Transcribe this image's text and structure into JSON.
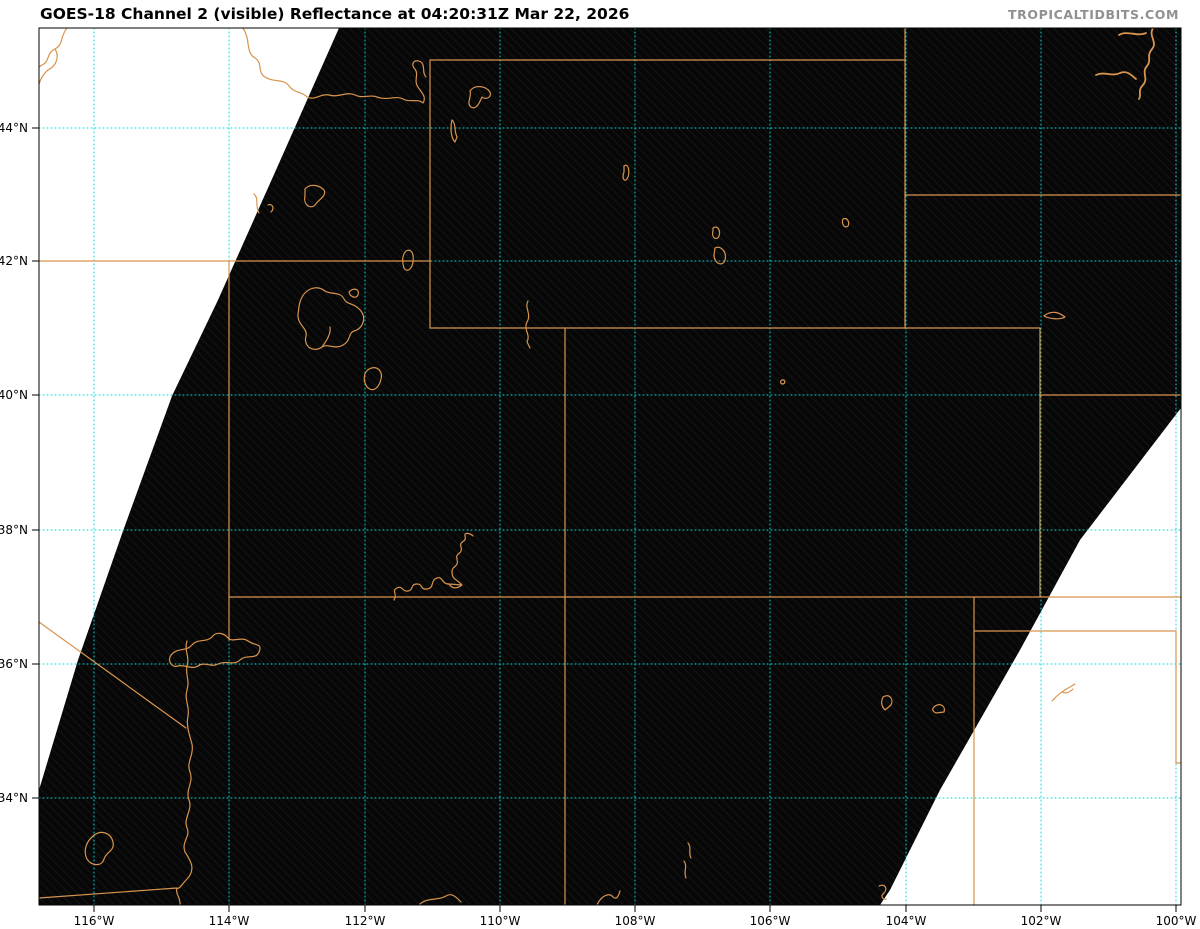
{
  "header": {
    "title": "GOES-18 Channel 2 (visible) Reflectance at 04:20:31Z Mar 22, 2026",
    "watermark": "TROPICALTIDBITS.COM"
  },
  "map": {
    "lat_labels": [
      "44°N",
      "42°N",
      "40°N",
      "38°N",
      "36°N",
      "34°N"
    ],
    "lon_labels": [
      "116°W",
      "114°W",
      "112°W",
      "110°W",
      "108°W",
      "106°W",
      "104°W",
      "102°W",
      "100°W"
    ],
    "colors": {
      "gridline": "#00dcdc",
      "map_lines": "#d8944e",
      "satellite_fill": "#070707",
      "background": "#ffffff",
      "title": "#000000",
      "watermark": "#909090"
    }
  }
}
